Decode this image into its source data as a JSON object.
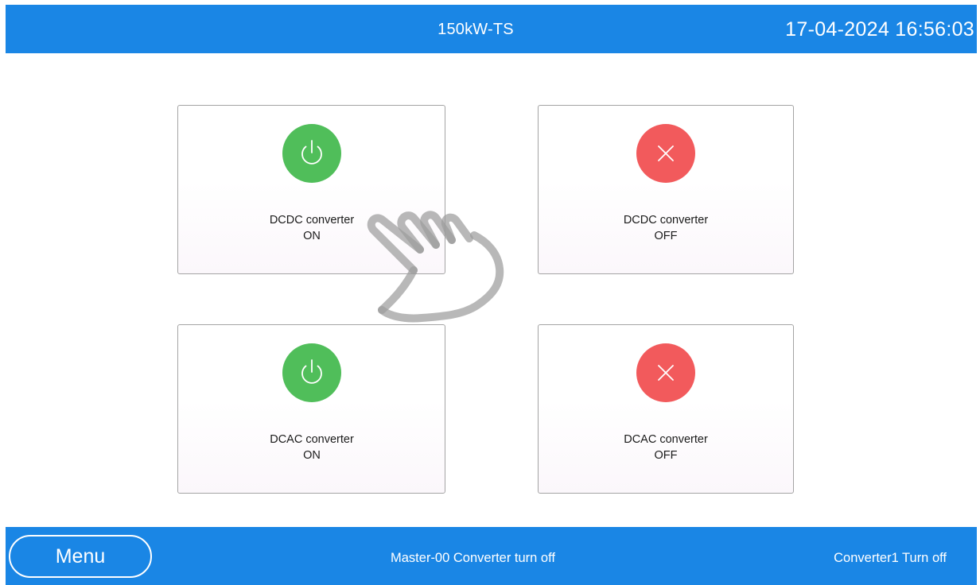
{
  "header": {
    "title": "150kW-TS",
    "datetime": "17-04-2024 16:56:03"
  },
  "cards": {
    "dcdc_on": {
      "line1": "DCDC converter",
      "line2": "ON",
      "icon": "power-icon",
      "color": "#50be5a"
    },
    "dcdc_off": {
      "line1": "DCDC converter",
      "line2": "OFF",
      "icon": "close-icon",
      "color": "#f25a5c"
    },
    "dcac_on": {
      "line1": "DCAC converter",
      "line2": "ON",
      "icon": "power-icon",
      "color": "#50be5a"
    },
    "dcac_off": {
      "line1": "DCAC converter",
      "line2": "OFF",
      "icon": "close-icon",
      "color": "#f25a5c"
    }
  },
  "overlay": {
    "icon": "hand-pointer-icon"
  },
  "footer": {
    "menu_label": "Menu",
    "message": "Master-00 Converter turn off",
    "alarm": "Converter1 Turn off"
  },
  "colors": {
    "bar_background": "#1a86e5",
    "on": "#50be5a",
    "off": "#f25a5c"
  }
}
